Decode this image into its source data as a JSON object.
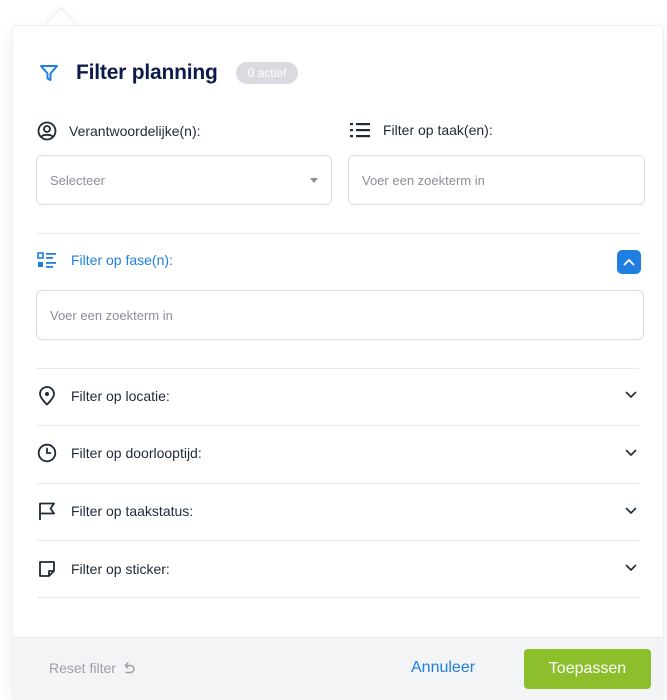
{
  "header": {
    "title": "Filter planning",
    "active_badge": "0 actief"
  },
  "responsible": {
    "label": "Verantwoordelijke(n):",
    "select_value": "Selecteer",
    "icon": "user-circle-icon"
  },
  "task": {
    "label": "Filter op taak(en):",
    "placeholder": "Voer een zoekterm in",
    "icon": "list-icon"
  },
  "phase": {
    "label": "Filter op fase(n):",
    "placeholder": "Voer een zoekterm in",
    "icon": "phase-list-icon",
    "expanded": true
  },
  "sections": [
    {
      "label": "Filter op locatie:",
      "icon": "location-pin-icon"
    },
    {
      "label": "Filter op doorlooptijd:",
      "icon": "clock-icon"
    },
    {
      "label": "Filter op taakstatus:",
      "icon": "flag-icon"
    },
    {
      "label": "Filter op sticker:",
      "icon": "sticker-icon"
    }
  ],
  "footer": {
    "reset_label": "Reset filter",
    "cancel_label": "Annuleer",
    "apply_label": "Toepassen"
  },
  "colors": {
    "accent_blue": "#1e7fe0",
    "title_navy": "#0c1b4b",
    "apply_green": "#8cbf2b",
    "badge_gray": "#d9dbe0"
  }
}
